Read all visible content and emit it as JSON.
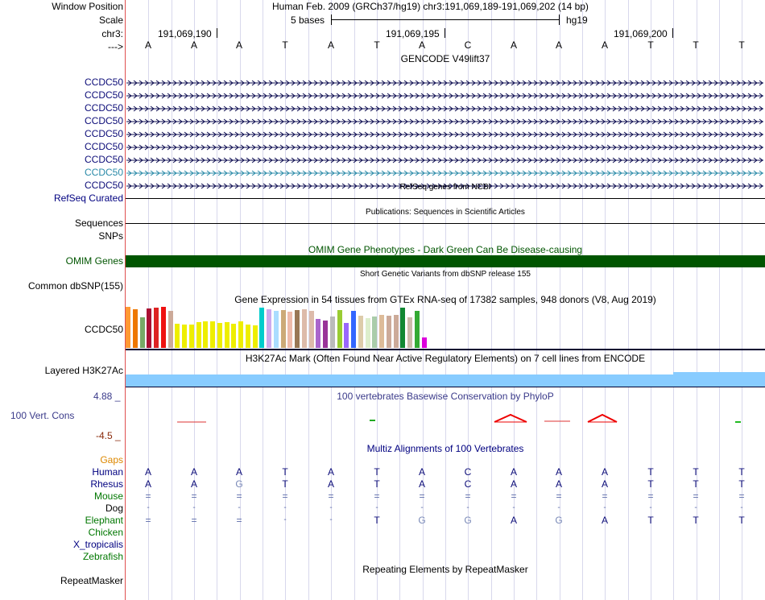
{
  "header": {
    "window_position_label": "Window Position",
    "scale_label": "Scale",
    "chr_label": "chr3:",
    "arrow_label": "--->",
    "title": "Human Feb. 2009 (GRCh37/hg19)   chr3:191,069,189-191,069,202 (14 bp)",
    "scale_text": "5 bases",
    "assembly": "hg19",
    "positions": [
      "191,069,190",
      "191,069,195",
      "191,069,200"
    ]
  },
  "bases": [
    "A",
    "A",
    "A",
    "T",
    "A",
    "T",
    "A",
    "C",
    "A",
    "A",
    "A",
    "T",
    "T",
    "T"
  ],
  "gencode": {
    "title": "GENCODE V49lift37",
    "genes": [
      "CCDC50",
      "CCDC50",
      "CCDC50",
      "CCDC50",
      "CCDC50",
      "CCDC50",
      "CCDC50",
      "CCDC50",
      "CCDC50"
    ],
    "highlight_index": 7
  },
  "refseq": {
    "label": "RefSeq Curated",
    "title": "RefSeq genes from NCBI"
  },
  "publications": {
    "label": "Sequences",
    "title": "Publications: Sequences in Scientific Articles"
  },
  "snps": {
    "label": "SNPs"
  },
  "omim": {
    "label": "OMIM Genes",
    "title": "OMIM Gene Phenotypes - Dark Green Can Be Disease-causing",
    "color": "#005500"
  },
  "dbsnp": {
    "label": "Common dbSNP(155)",
    "title": "Short Genetic Variants from dbSNP release 155"
  },
  "gtex": {
    "label": "CCDC50",
    "title": "Gene Expression in 54 tissues from GTEx RNA-seq of 17382 samples, 948 donors (V8, Aug 2019)",
    "bars": [
      {
        "c": "#ff9933",
        "v": 0.96
      },
      {
        "c": "#ee7700",
        "v": 0.9
      },
      {
        "c": "#77aa66",
        "v": 0.72
      },
      {
        "c": "#aa1133",
        "v": 0.92
      },
      {
        "c": "#dd2222",
        "v": 0.94
      },
      {
        "c": "#ee1111",
        "v": 0.96
      },
      {
        "c": "#ccaa99",
        "v": 0.86
      },
      {
        "c": "#eeee00",
        "v": 0.56
      },
      {
        "c": "#eeee00",
        "v": 0.55
      },
      {
        "c": "#eeee00",
        "v": 0.54
      },
      {
        "c": "#eeee00",
        "v": 0.6
      },
      {
        "c": "#eeee00",
        "v": 0.63
      },
      {
        "c": "#eeee00",
        "v": 0.62
      },
      {
        "c": "#eeee00",
        "v": 0.58
      },
      {
        "c": "#eeee00",
        "v": 0.6
      },
      {
        "c": "#eeee00",
        "v": 0.57
      },
      {
        "c": "#eeee00",
        "v": 0.62
      },
      {
        "c": "#eeee00",
        "v": 0.54
      },
      {
        "c": "#eeee00",
        "v": 0.52
      },
      {
        "c": "#00cccc",
        "v": 0.95
      },
      {
        "c": "#ccaaee",
        "v": 0.9
      },
      {
        "c": "#aaddff",
        "v": 0.86
      },
      {
        "c": "#ccaa77",
        "v": 0.88
      },
      {
        "c": "#eebbaa",
        "v": 0.85
      },
      {
        "c": "#997755",
        "v": 0.88
      },
      {
        "c": "#ddbbaa",
        "v": 0.9
      },
      {
        "c": "#ddbbaa",
        "v": 0.86
      },
      {
        "c": "#aa66cc",
        "v": 0.68
      },
      {
        "c": "#993399",
        "v": 0.64
      },
      {
        "c": "#bbbbbb",
        "v": 0.74
      },
      {
        "c": "#99cc33",
        "v": 0.88
      },
      {
        "c": "#9966ff",
        "v": 0.58
      },
      {
        "c": "#3366ff",
        "v": 0.86
      },
      {
        "c": "#ddccaa",
        "v": 0.75
      },
      {
        "c": "#ddeecc",
        "v": 0.7
      },
      {
        "c": "#aaccaa",
        "v": 0.74
      },
      {
        "c": "#ddbb99",
        "v": 0.78
      },
      {
        "c": "#ccaa99",
        "v": 0.76
      },
      {
        "c": "#ccaa99",
        "v": 0.78
      },
      {
        "c": "#118833",
        "v": 0.94
      },
      {
        "c": "#ccbbaa",
        "v": 0.72
      },
      {
        "c": "#33aa33",
        "v": 0.86
      },
      {
        "c": "#dd00dd",
        "v": 0.24
      }
    ]
  },
  "h3k27ac": {
    "label": "Layered H3K27Ac",
    "title": "H3K27Ac Mark (Often Found Near Active Regulatory Elements) on 7 cell lines from ENCODE",
    "color": "#88ccff"
  },
  "conservation": {
    "label": "100 Vert. Cons",
    "max": "4.88 _",
    "min": "-4.5 _",
    "title": "100 vertebrates Basewise Conservation by PhyloP"
  },
  "multiz": {
    "title": "Multiz Alignments of 100 Vertebrates",
    "rows": [
      {
        "name": "Gaps",
        "color": "#dd8800",
        "bases": []
      },
      {
        "name": "Human",
        "color": "#000080",
        "bases": [
          "A",
          "A",
          "A",
          "T",
          "A",
          "T",
          "A",
          "C",
          "A",
          "A",
          "A",
          "T",
          "T",
          "T"
        ]
      },
      {
        "name": "Rhesus",
        "color": "#000080",
        "bases": [
          "A",
          "A",
          "G",
          "T",
          "A",
          "T",
          "A",
          "C",
          "A",
          "A",
          "A",
          "T",
          "T",
          "T"
        ]
      },
      {
        "name": "Mouse",
        "color": "#007700",
        "bases": [
          "=",
          "=",
          "=",
          "=",
          "=",
          "=",
          "=",
          "=",
          "=",
          "=",
          "=",
          "=",
          "=",
          "="
        ]
      },
      {
        "name": "Dog",
        "color": "#000000",
        "bases": [
          "-",
          "-",
          "-",
          "-",
          "-",
          "-",
          "-",
          "-",
          "-",
          "-",
          "-",
          "-",
          "-",
          "-"
        ]
      },
      {
        "name": "Elephant",
        "color": "#007700",
        "bases": [
          "=",
          "=",
          "=",
          "-",
          "-",
          "T",
          "G",
          "G",
          "A",
          "G",
          "A",
          "T",
          "T",
          "T"
        ]
      },
      {
        "name": "Chicken",
        "color": "#007700",
        "bases": []
      },
      {
        "name": "X_tropicalis",
        "color": "#000080",
        "bases": []
      },
      {
        "name": "Zebrafish",
        "color": "#007700",
        "bases": []
      }
    ]
  },
  "repeatmasker": {
    "label": "RepeatMasker",
    "title": "Repeating Elements by RepeatMasker"
  }
}
